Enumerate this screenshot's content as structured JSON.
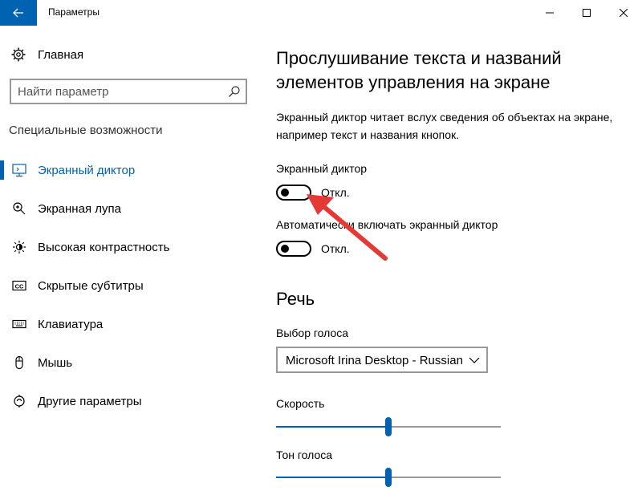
{
  "window": {
    "title": "Параметры"
  },
  "sidebar": {
    "home_label": "Главная",
    "search_placeholder": "Найти параметр",
    "section_label": "Специальные возможности",
    "items": [
      {
        "label": "Экранный диктор",
        "icon": "narrator-icon",
        "active": true
      },
      {
        "label": "Экранная лупа",
        "icon": "magnifier-icon",
        "active": false
      },
      {
        "label": "Высокая контрастность",
        "icon": "contrast-icon",
        "active": false
      },
      {
        "label": "Скрытые субтитры",
        "icon": "cc-icon",
        "active": false
      },
      {
        "label": "Клавиатура",
        "icon": "keyboard-icon",
        "active": false
      },
      {
        "label": "Мышь",
        "icon": "mouse-icon",
        "active": false
      },
      {
        "label": "Другие параметры",
        "icon": "other-settings-icon",
        "active": false
      }
    ]
  },
  "main": {
    "title": "Прослушивание текста и названий элементов управления на экране",
    "description": "Экранный диктор читает вслух сведения об объектах на экране, например текст и названия кнопок.",
    "narrator": {
      "label": "Экранный диктор",
      "state": "Откл."
    },
    "auto_start": {
      "label": "Автоматически включать экранный диктор",
      "state": "Откл."
    },
    "speech": {
      "title": "Речь",
      "voice_label": "Выбор голоса",
      "voice_value": "Microsoft Irina Desktop - Russian",
      "speed_label": "Скорость",
      "speed_value": 0.5,
      "pitch_label": "Тон голоса",
      "pitch_value": 0.5
    }
  },
  "colors": {
    "accent": "#0063b1",
    "annotation": "#e53935"
  }
}
